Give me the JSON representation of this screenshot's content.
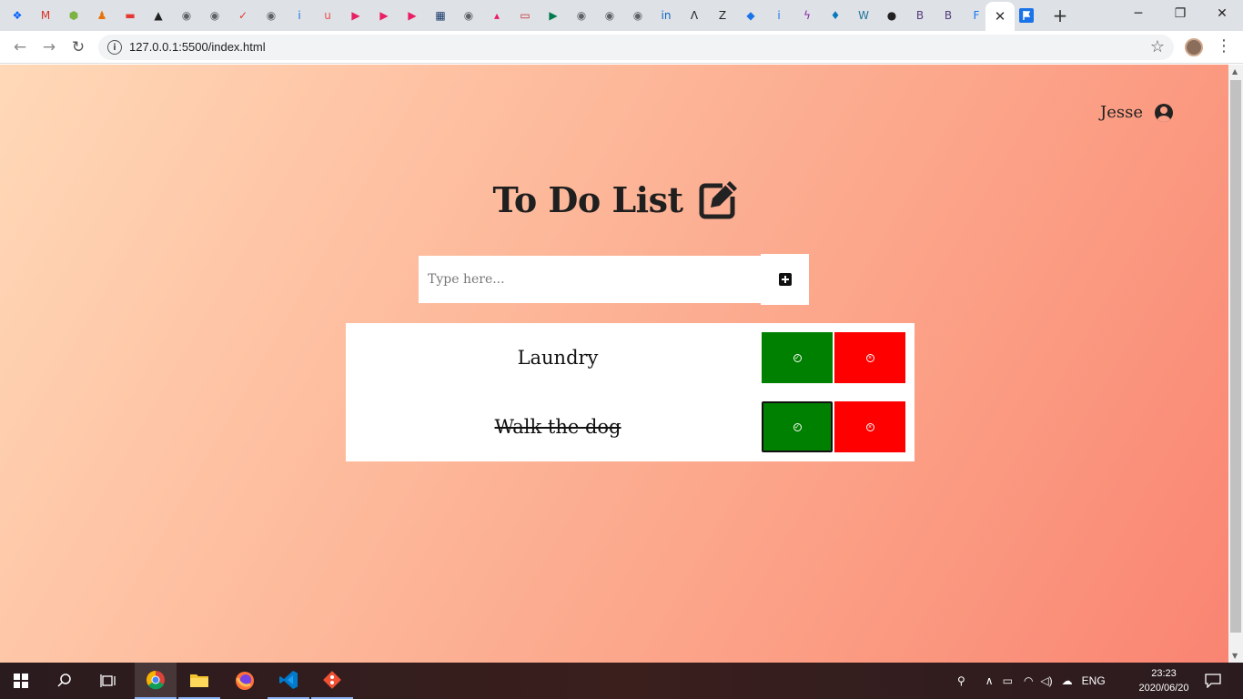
{
  "browser": {
    "tab_icons": [
      {
        "name": "dropbox-icon",
        "glyph": "❖",
        "color": "#0061fe"
      },
      {
        "name": "gmail-icon",
        "glyph": "M",
        "color": "#d93025"
      },
      {
        "name": "hexagon-icon",
        "glyph": "⬢",
        "color": "#7cb342"
      },
      {
        "name": "person-icon",
        "glyph": "♟",
        "color": "#e8710a"
      },
      {
        "name": "bus-icon",
        "glyph": "▬",
        "color": "#e53935"
      },
      {
        "name": "arch-icon",
        "glyph": "▲",
        "color": "#222222"
      },
      {
        "name": "globe-icon",
        "glyph": "◉",
        "color": "#5f6368"
      },
      {
        "name": "globe-icon",
        "glyph": "◉",
        "color": "#5f6368"
      },
      {
        "name": "checkmark-icon",
        "glyph": "✓",
        "color": "#e53935"
      },
      {
        "name": "globe-icon",
        "glyph": "◉",
        "color": "#5f6368"
      },
      {
        "name": "info-icon",
        "glyph": "i",
        "color": "#1a73e8"
      },
      {
        "name": "udemy-icon",
        "glyph": "u",
        "color": "#ec5252"
      },
      {
        "name": "play-icon",
        "glyph": "▶",
        "color": "#e91e63"
      },
      {
        "name": "play-icon",
        "glyph": "▶",
        "color": "#e91e63"
      },
      {
        "name": "play-icon",
        "glyph": "▶",
        "color": "#e91e63"
      },
      {
        "name": "news-icon",
        "glyph": "▦",
        "color": "#1a3a6b"
      },
      {
        "name": "globe-icon",
        "glyph": "◉",
        "color": "#5f6368"
      },
      {
        "name": "graduation-icon",
        "glyph": "▴",
        "color": "#e91e63"
      },
      {
        "name": "flag-icon",
        "glyph": "▭",
        "color": "#c62828"
      },
      {
        "name": "south-africa-flag-icon",
        "glyph": "▶",
        "color": "#007a4d"
      },
      {
        "name": "globe-icon",
        "glyph": "◉",
        "color": "#5f6368"
      },
      {
        "name": "globe-icon",
        "glyph": "◉",
        "color": "#5f6368"
      },
      {
        "name": "globe-icon",
        "glyph": "◉",
        "color": "#5f6368"
      },
      {
        "name": "linkedin-icon",
        "glyph": "in",
        "color": "#0a66c2"
      },
      {
        "name": "a-icon",
        "glyph": "Λ",
        "color": "#222222"
      },
      {
        "name": "z-icon",
        "glyph": "Z",
        "color": "#222222"
      },
      {
        "name": "bookmark-icon",
        "glyph": "◆",
        "color": "#1a73e8"
      },
      {
        "name": "info-icon",
        "glyph": "i",
        "color": "#1a73e8"
      },
      {
        "name": "bolt-icon",
        "glyph": "ϟ",
        "color": "#8e24aa"
      },
      {
        "name": "drupal-icon",
        "glyph": "♦",
        "color": "#0678be"
      },
      {
        "name": "wordpress-icon",
        "glyph": "W",
        "color": "#21759b"
      },
      {
        "name": "github-icon",
        "glyph": "●",
        "color": "#222222"
      },
      {
        "name": "bootstrap-icon",
        "glyph": "B",
        "color": "#563d7c"
      },
      {
        "name": "bootstrap-icon",
        "glyph": "B",
        "color": "#563d7c"
      },
      {
        "name": "facebook-icon",
        "glyph": "F",
        "color": "#1877f2"
      }
    ],
    "active_tab_close": "✕",
    "new_tab": "+",
    "address": "127.0.0.1:5500/index.html"
  },
  "page": {
    "user_name": "Jesse",
    "title": "To Do List",
    "input_placeholder": "Type here...",
    "todos": [
      {
        "text": "Laundry",
        "completed": false
      },
      {
        "text": "Walk the dog",
        "completed": true
      }
    ],
    "complete_glyph": "✓",
    "delete_glyph": "×"
  },
  "taskbar": {
    "language": "ENG",
    "time": "23:23",
    "date": "2020/06/20"
  },
  "colors": {
    "complete": "#008000",
    "delete": "#ff0000",
    "gradient_start": "#ffd9b8",
    "gradient_end": "#f98472"
  }
}
